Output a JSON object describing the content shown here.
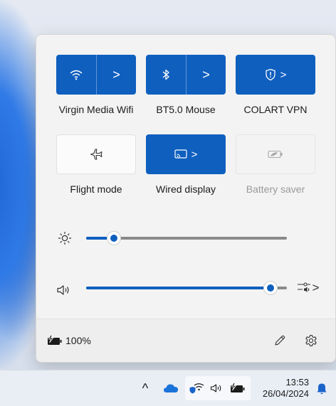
{
  "quick_settings": {
    "tiles": [
      {
        "label": "Virgin Media Wifi",
        "icon": "wifi-icon",
        "state": "on"
      },
      {
        "label": "BT5.0 Mouse",
        "icon": "bluetooth-icon",
        "state": "on"
      },
      {
        "label": "COLART VPN",
        "icon": "vpn-shield-icon",
        "state": "on"
      },
      {
        "label": "Flight mode",
        "icon": "airplane-icon",
        "state": "off"
      },
      {
        "label": "Wired display",
        "icon": "cast-icon",
        "state": "on"
      },
      {
        "label": "Battery saver",
        "icon": "battery-saver-icon",
        "state": "disabled"
      }
    ],
    "chevron": ">",
    "brightness_level": 0.14,
    "volume_level": 0.92,
    "volume_mixer_chevron": ">"
  },
  "footer": {
    "battery_percent": "100%"
  },
  "taskbar": {
    "overflow_chevron": "^",
    "time": "13:53",
    "date": "26/04/2024"
  },
  "colors": {
    "accent": "#0f5fbf"
  }
}
